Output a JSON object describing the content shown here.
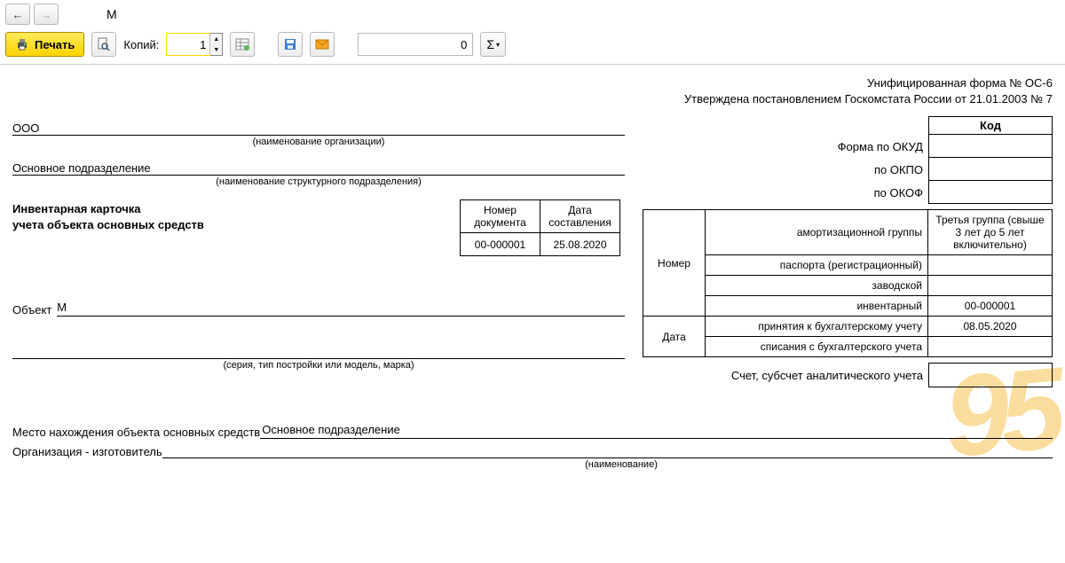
{
  "window": {
    "title": "М"
  },
  "toolbar": {
    "print": "Печать",
    "copies_label": "Копий:",
    "copies_value": "1",
    "num_value": "0",
    "sigma": "Σ"
  },
  "header": {
    "form_line1": "Унифицированная форма № ОС-6",
    "form_line2": "Утверждена постановлением Госкомстата России от 21.01.2003 № 7"
  },
  "left": {
    "org_value": "ООО",
    "org_caption": "(наименование организации)",
    "dept_value": "Основное подразделение",
    "dept_caption": "(наименование структурного подразделения)",
    "card_title_1": "Инвентарная карточка",
    "card_title_2": "учета объекта основных средств",
    "doc_num_hdr": "Номер документа",
    "doc_date_hdr": "Дата составления",
    "doc_num": "00-000001",
    "doc_date": "25.08.2020",
    "object_label": "Объект",
    "object_value": "М",
    "series_caption": "(серия, тип постройки или модель, марка)"
  },
  "codes": {
    "kod": "Код",
    "okud": "Форма по ОКУД",
    "okpo": "по ОКПО",
    "okof": "по ОКОФ"
  },
  "grid": {
    "number_label": "Номер",
    "date_label": "Дата",
    "amort_group": "амортизационной группы",
    "amort_group_val": "Третья группа (свыше 3 лет до 5 лет включительно)",
    "passport": "паспорта (регистрационный)",
    "factory": "заводской",
    "inventory": "инвентарный",
    "inventory_val": "00-000001",
    "accept": "принятия к бухгалтерскому учету",
    "accept_val": "08.05.2020",
    "writeoff": "списания с бухгалтерского учета",
    "account_label": "Счет, субсчет аналитического учета"
  },
  "bottom": {
    "location_label": "Место нахождения объекта основных средств",
    "location_value": "Основное подразделение",
    "manuf_label": "Организация - изготовитель",
    "manuf_caption": "(наименование)"
  },
  "watermark": "95"
}
